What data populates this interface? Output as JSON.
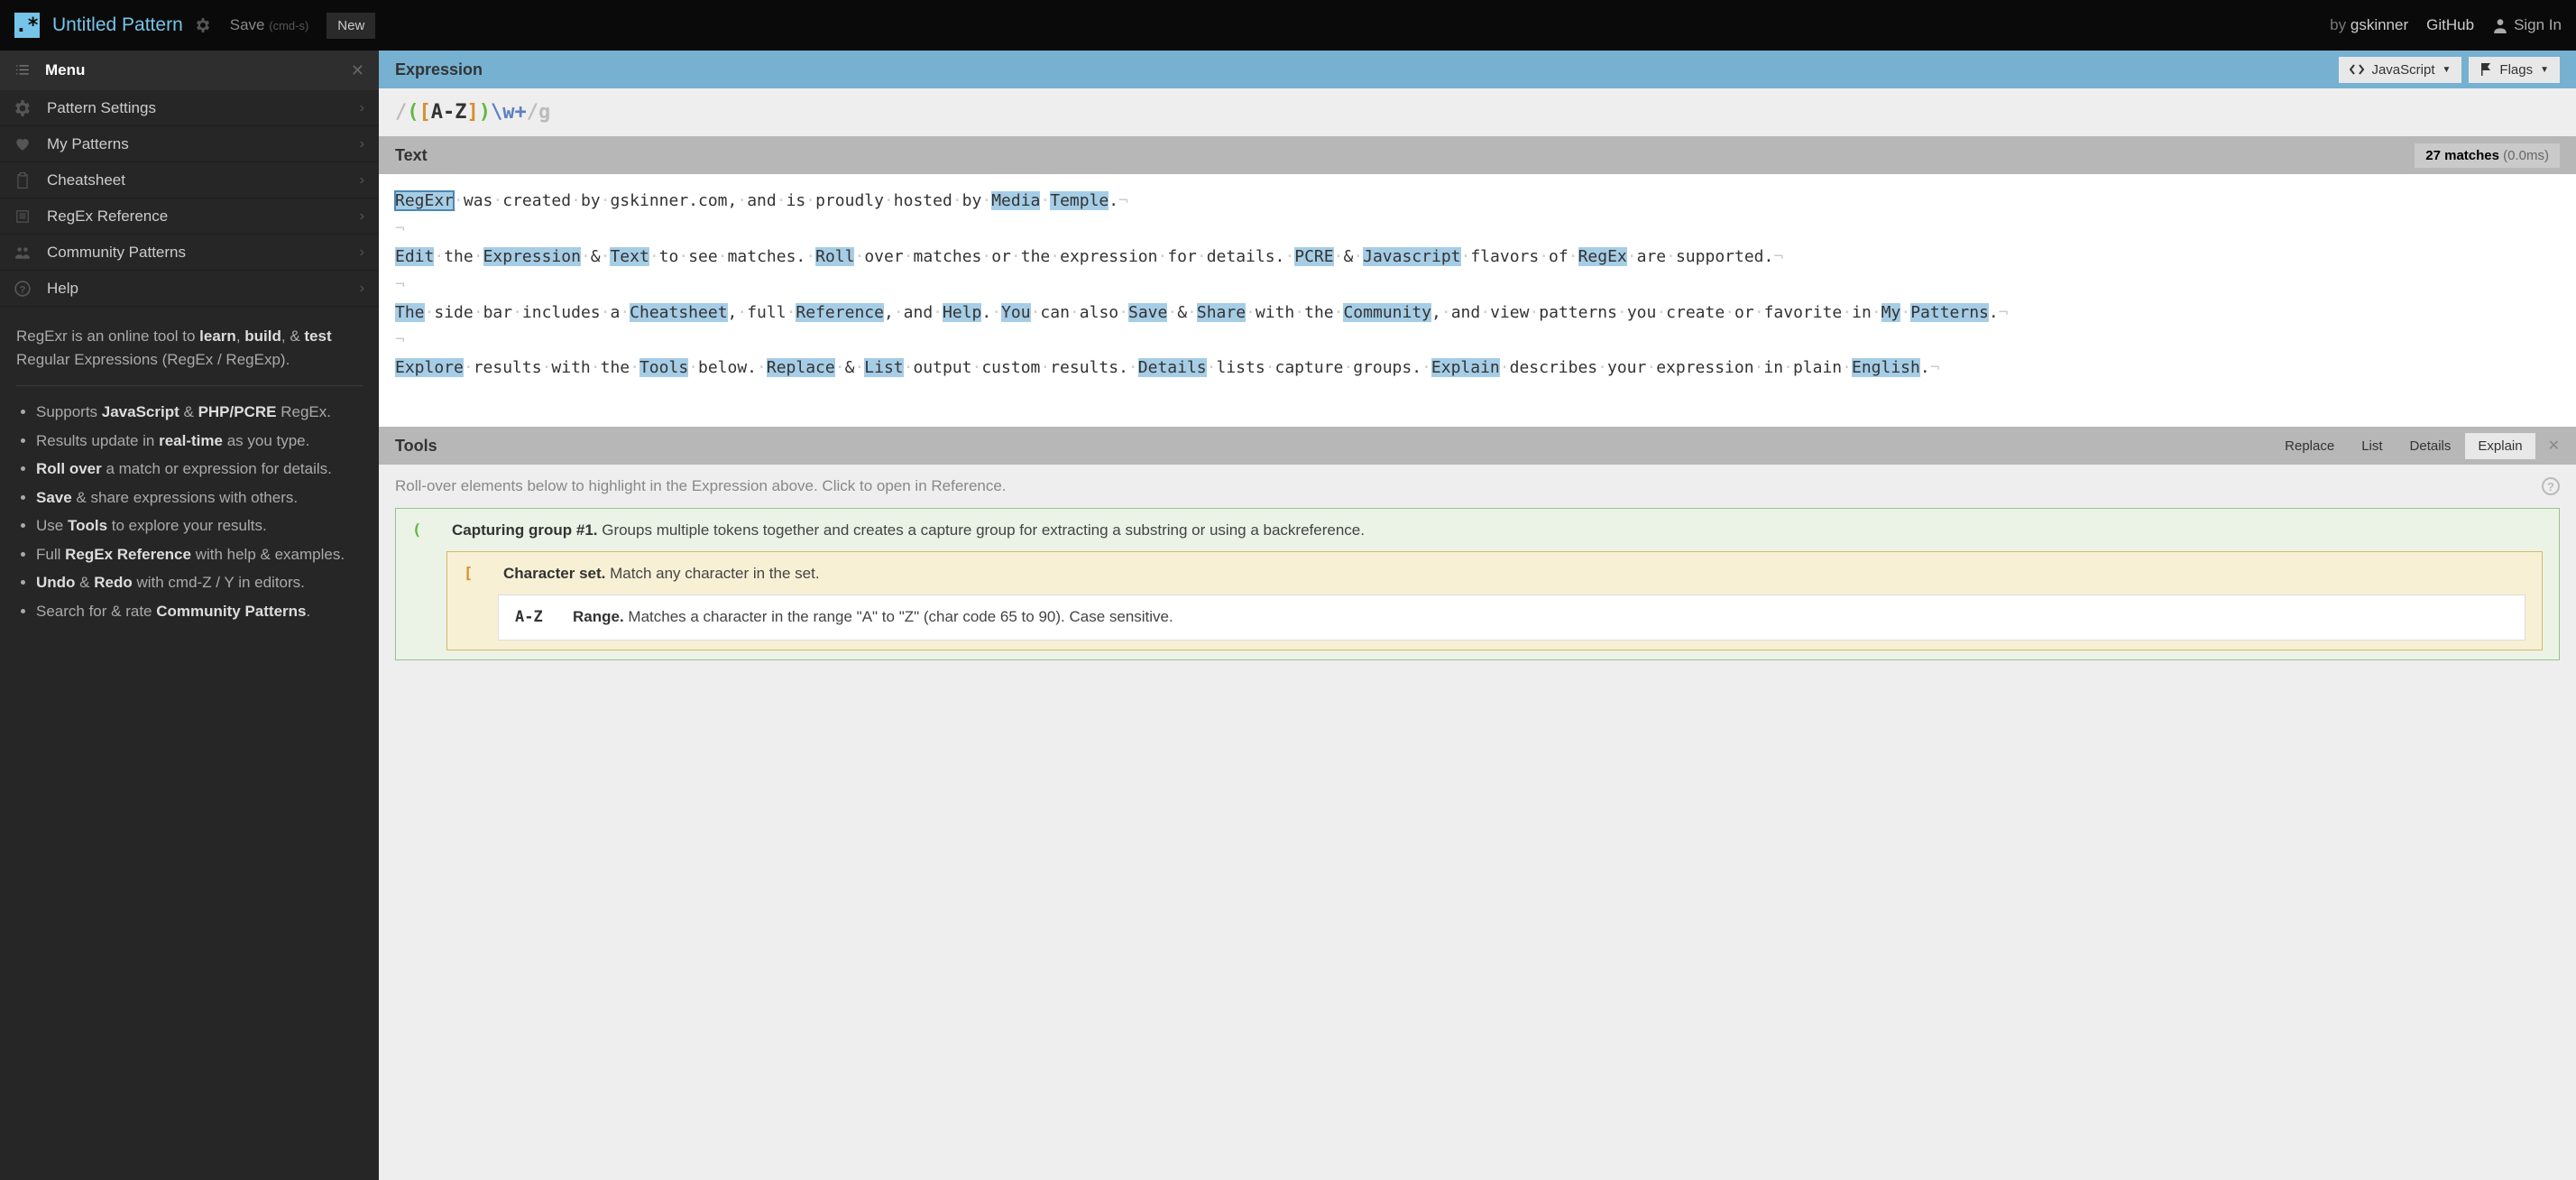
{
  "topbar": {
    "title": "Untitled Pattern",
    "save": "Save",
    "save_hint": "(cmd-s)",
    "new": "New",
    "by": "by",
    "author": "gskinner",
    "github": "GitHub",
    "signin": "Sign In"
  },
  "sidebar": {
    "menu_title": "Menu",
    "items": [
      {
        "label": "Pattern Settings",
        "icon": "gear"
      },
      {
        "label": "My Patterns",
        "icon": "heart"
      },
      {
        "label": "Cheatsheet",
        "icon": "clipboard"
      },
      {
        "label": "RegEx Reference",
        "icon": "book"
      },
      {
        "label": "Community Patterns",
        "icon": "people"
      },
      {
        "label": "Help",
        "icon": "question"
      }
    ],
    "intro_pre": "RegExr is an online tool to ",
    "intro_learn": "learn",
    "intro_build": "build",
    "intro_amp": ", & ",
    "intro_test": "test",
    "intro_post": " Regular Expressions (RegEx / RegExp).",
    "bullets": [
      {
        "pre": "Supports ",
        "b1": "JavaScript",
        "mid": " & ",
        "b2": "PHP/PCRE",
        "post": " RegEx."
      },
      {
        "pre": "Results update in ",
        "b1": "real-time",
        "post": " as you type."
      },
      {
        "b1": "Roll over",
        "post": " a match or expression for details."
      },
      {
        "b1": "Save",
        "post": " & share expressions with others."
      },
      {
        "pre": "Use ",
        "b1": "Tools",
        "post": " to explore your results."
      },
      {
        "pre": "Full ",
        "b1": "RegEx Reference",
        "post": " with help & examples."
      },
      {
        "b1": "Undo",
        "mid": " & ",
        "b2": "Redo",
        "post": " with cmd-Z / Y in editors."
      },
      {
        "pre": "Search for & rate ",
        "b1": "Community Patterns",
        "post": "."
      }
    ]
  },
  "expression": {
    "header": "Expression",
    "flavor": "JavaScript",
    "flags": "Flags",
    "tokens": {
      "open_slash": "/",
      "open_paren": "(",
      "open_bracket": "[",
      "range": "A-Z",
      "close_bracket": "]",
      "close_paren": ")",
      "class": "\\w",
      "plus": "+",
      "close_slash": "/",
      "flag_g": "g"
    }
  },
  "text": {
    "header": "Text",
    "match_count": "27 matches",
    "match_time": "(0.0ms)"
  },
  "tools": {
    "header": "Tools",
    "tabs": {
      "replace": "Replace",
      "list": "List",
      "details": "Details",
      "explain": "Explain"
    },
    "hint": "Roll-over elements below to highlight in the Expression above. Click to open in Reference.",
    "explain": {
      "group_token": "(",
      "group_title": "Capturing group #1.",
      "group_text": " Groups multiple tokens together and creates a capture group for extracting a substring or using a backreference.",
      "set_token": "[",
      "set_title": "Character set.",
      "set_text": " Match any character in the set.",
      "range_token": "A-Z",
      "range_title": "Range.",
      "range_text": " Matches a character in the range \"A\" to \"Z\" (char code 65 to 90). Case sensitive."
    }
  }
}
